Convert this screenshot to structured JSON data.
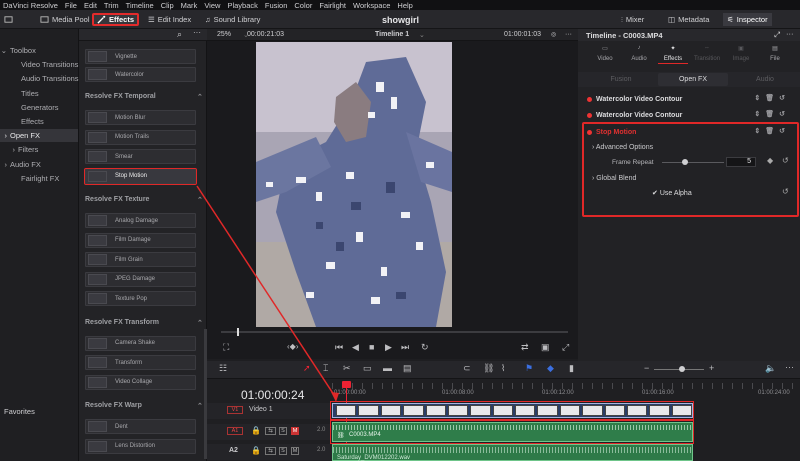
{
  "app": "DaVinci Resolve",
  "menu": [
    "DaVinci Resolve",
    "File",
    "Edit",
    "Trim",
    "Timeline",
    "Clip",
    "Mark",
    "View",
    "Playback",
    "Fusion",
    "Color",
    "Fairlight",
    "Workspace",
    "Help"
  ],
  "toolbar": {
    "media_pool": "Media Pool",
    "effects": "Effects",
    "edit_index": "Edit Index",
    "sound_library": "Sound Library",
    "project": "showgirl",
    "mixer": "Mixer",
    "metadata": "Metadata",
    "inspector": "Inspector"
  },
  "left_panel": {
    "items": [
      {
        "label": "Toolbox",
        "level": 0,
        "arrow": "⌄"
      },
      {
        "label": "Video Transitions",
        "level": 1
      },
      {
        "label": "Audio Transitions",
        "level": 1
      },
      {
        "label": "Titles",
        "level": 1
      },
      {
        "label": "Generators",
        "level": 1
      },
      {
        "label": "Effects",
        "level": 1
      },
      {
        "label": "Open FX",
        "level": 0,
        "arrow": "›",
        "selected": true
      },
      {
        "label": "Filters",
        "level": 1,
        "arrow": "›"
      },
      {
        "label": "Audio FX",
        "level": 0,
        "arrow": "›"
      },
      {
        "label": "Fairlight FX",
        "level": 1
      }
    ],
    "favorites": "Favorites"
  },
  "effects_list": {
    "top_tiles": [
      "Vignette",
      "Watercolor"
    ],
    "sections": [
      {
        "title": "Resolve FX Temporal",
        "items": [
          "Motion Blur",
          "Motion Trails",
          "Smear",
          "Stop Motion"
        ]
      },
      {
        "title": "Resolve FX Texture",
        "items": [
          "Analog Damage",
          "Film Damage",
          "Film Grain",
          "JPEG Damage",
          "Texture Pop"
        ]
      },
      {
        "title": "Resolve FX Transform",
        "items": [
          "Camera Shake",
          "Transform",
          "Video Collage"
        ]
      },
      {
        "title": "Resolve FX Warp",
        "items": [
          "Dent",
          "Lens Distortion"
        ]
      }
    ],
    "highlighted": "Stop Motion"
  },
  "viewer": {
    "zoom": "25%",
    "timecode_left": "00:00:21:03",
    "timeline_name": "Timeline 1",
    "timecode_right": "01:00:01:03"
  },
  "inspector": {
    "title": "Timeline - C0003.MP4",
    "tabs": [
      "Video",
      "Audio",
      "Effects",
      "Transition",
      "Image",
      "File"
    ],
    "selected_tab": "Effects",
    "subtabs": [
      "Fusion",
      "Open FX",
      "Audio"
    ],
    "selected_subtab": "Open FX",
    "effects": [
      "Watercolor Video Contour",
      "Watercolor Video Contour",
      "Stop Motion"
    ],
    "stop_motion": {
      "advanced_options": "Advanced Options",
      "frame_repeat_label": "Frame Repeat",
      "frame_repeat": "5",
      "global_blend": "Global Blend",
      "use_alpha": "Use Alpha"
    }
  },
  "timeline": {
    "timecode": "01:00:00:24",
    "ruler": [
      "01:00:00:00",
      "01:00:08:00",
      "01:00:12:00",
      "01:00:16:00",
      "01:00:24:00"
    ],
    "tracks": [
      {
        "id": "V1",
        "name": "Video 1"
      },
      {
        "id": "A1",
        "name": "",
        "level": "2.0"
      },
      {
        "id": "A2",
        "name": "",
        "level": "2.0"
      }
    ],
    "clip_a1": "C0003.MP4",
    "clip_a2": "Saturday_DVM012202.wav"
  },
  "colors": {
    "accent": "#e02828",
    "panel": "#232326",
    "video_clip": "#2a3d66",
    "audio_clip": "#2f7d4a"
  }
}
